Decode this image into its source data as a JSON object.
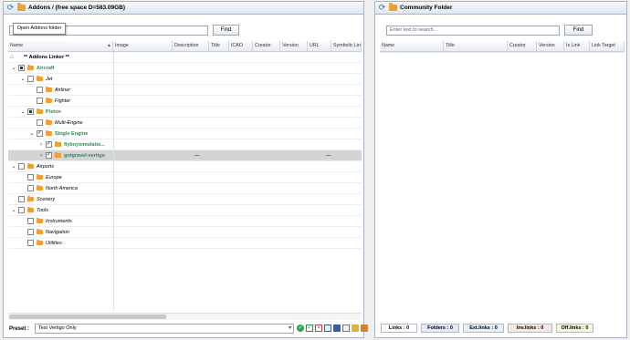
{
  "left": {
    "title": "Addons /  (free space D=583.09GB)",
    "search_placeholder": "",
    "find_label": "Find",
    "tooltip": "Open Addons folder",
    "columns": [
      "Name",
      "Image",
      "Description",
      "Title",
      "ICAO",
      "Creator",
      "Version",
      "URL",
      "Symbolic Link"
    ],
    "rows": [
      {
        "label": "** Addons Linker **",
        "depth": 0,
        "style": "bold",
        "exp": "",
        "cb": "none",
        "folder": false,
        "home": true
      },
      {
        "label": "Aircraft",
        "depth": 0,
        "style": "green",
        "exp": "⌄",
        "cb": "ind",
        "folder": true
      },
      {
        "label": "Jet",
        "depth": 1,
        "style": "italic",
        "exp": "⌄",
        "cb": "empty",
        "folder": true
      },
      {
        "label": "Airliner",
        "depth": 2,
        "style": "italic",
        "exp": "",
        "cb": "empty",
        "folder": true
      },
      {
        "label": "Fighter",
        "depth": 2,
        "style": "italic",
        "exp": "",
        "cb": "empty",
        "folder": true
      },
      {
        "label": "Piston",
        "depth": 1,
        "style": "green",
        "exp": "⌄",
        "cb": "ind",
        "folder": true
      },
      {
        "label": "Multi-Engine",
        "depth": 2,
        "style": "italic",
        "exp": "",
        "cb": "empty",
        "folder": true
      },
      {
        "label": "Single Engine",
        "depth": 2,
        "style": "green",
        "exp": "⌄",
        "cb": "checked",
        "folder": true
      },
      {
        "label": "flyboysimulatio...",
        "depth": 3,
        "style": "green",
        "exp": "›",
        "cb": "checked",
        "folder": true
      },
      {
        "label": "gotgravel-vertigo",
        "depth": 3,
        "style": "green",
        "exp": "›",
        "cb": "checked",
        "folder": true,
        "selected": true,
        "desc": "—",
        "url": "—"
      },
      {
        "label": "Airports",
        "depth": 0,
        "style": "italic",
        "exp": "⌄",
        "cb": "empty",
        "folder": true
      },
      {
        "label": "Europe",
        "depth": 1,
        "style": "italic",
        "exp": "",
        "cb": "empty",
        "folder": true
      },
      {
        "label": "North America",
        "depth": 1,
        "style": "italic",
        "exp": "",
        "cb": "empty",
        "folder": true
      },
      {
        "label": "Scenery",
        "depth": 0,
        "style": "italic",
        "exp": "",
        "cb": "empty",
        "folder": true
      },
      {
        "label": "Tools",
        "depth": 0,
        "style": "italic",
        "exp": "⌄",
        "cb": "empty",
        "folder": true
      },
      {
        "label": "Instruments",
        "depth": 1,
        "style": "italic",
        "exp": "",
        "cb": "empty",
        "folder": true
      },
      {
        "label": "Navigation",
        "depth": 1,
        "style": "italic",
        "exp": "",
        "cb": "empty",
        "folder": true
      },
      {
        "label": "Utilities",
        "depth": 1,
        "style": "italic",
        "exp": "",
        "cb": "empty",
        "folder": true
      }
    ],
    "preset_label": "Preset :",
    "preset_value": "Test Vertigo Only"
  },
  "right": {
    "title": "Community Folder",
    "search_placeholder": "Enter text to search...",
    "find_label": "Find",
    "columns": [
      "Name",
      "Title",
      "Creator",
      "Version",
      "Is Link",
      "Link Target"
    ],
    "status": [
      {
        "label": "Links : 0",
        "bg": "#ffffff"
      },
      {
        "label": "Folders : 0",
        "bg": "#e8e8fb"
      },
      {
        "label": "Ext.links : 0",
        "bg": "#e4f1fb"
      },
      {
        "label": "Inv.links : 0",
        "bg": "#fbe8e4"
      },
      {
        "label": "Off.links : 0",
        "bg": "#fbf8e0"
      }
    ]
  }
}
